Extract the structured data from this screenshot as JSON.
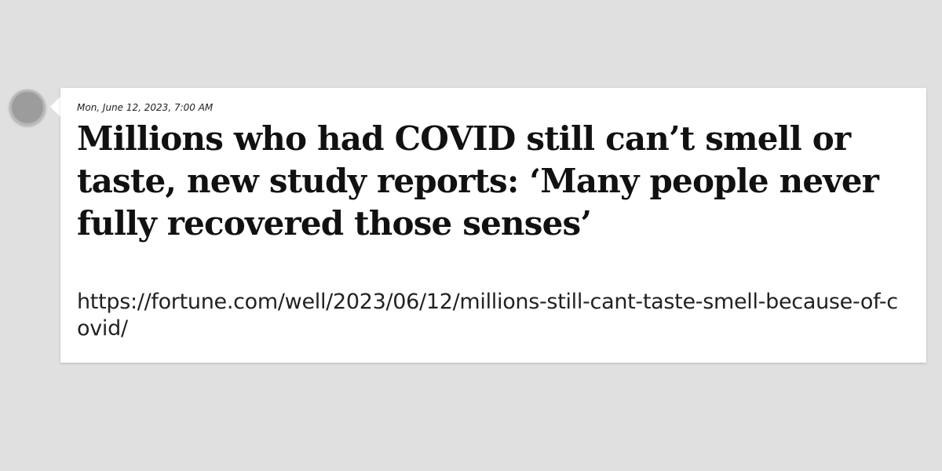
{
  "post": {
    "timestamp": "Mon, June 12, 2023, 7:00 AM",
    "headline": "Millions who had COVID still can’t smell or taste, new study reports: ‘Many people never fully recovered those senses’",
    "url": "https://fortune.com/well/2023/06/12/millions-still-cant-taste-smell-because-of-covid/"
  },
  "colors": {
    "background": "#e0e0e0",
    "card": "#ffffff",
    "avatar": "#9c9c9c"
  }
}
